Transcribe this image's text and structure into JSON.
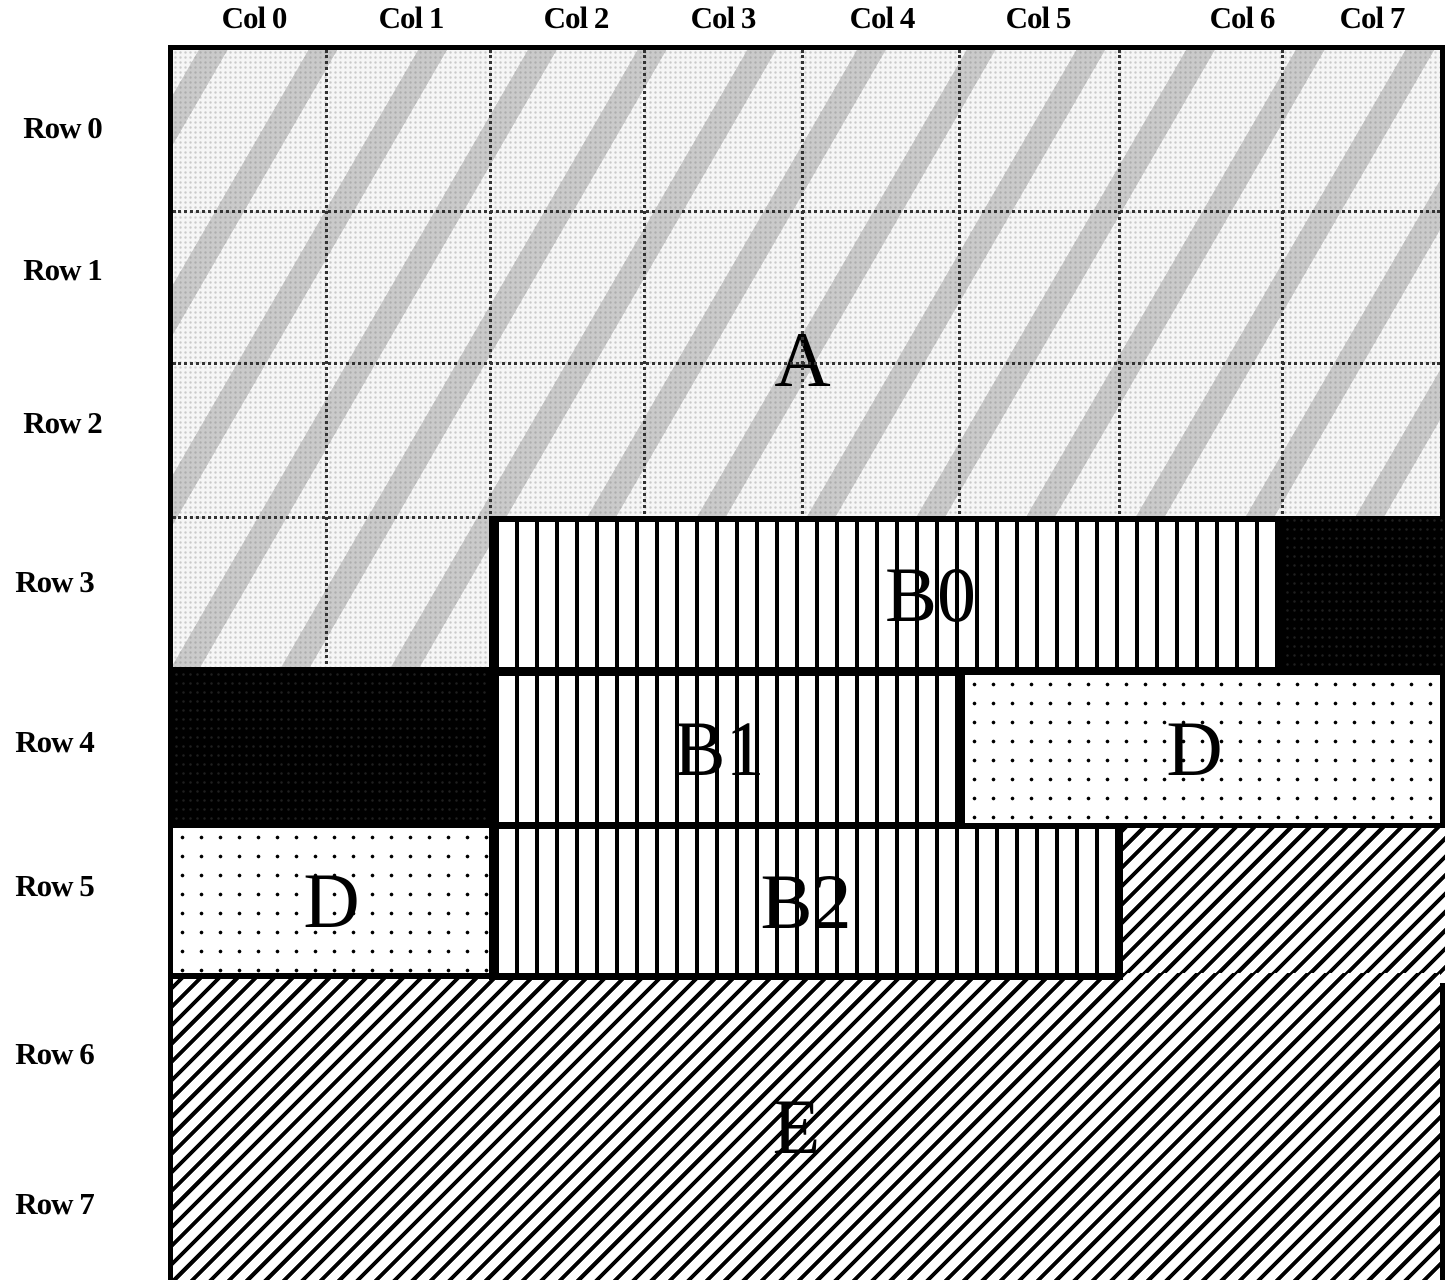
{
  "columns": [
    "Col 0",
    "Col 1",
    "Col 2",
    "Col 3",
    "Col 4",
    "Col 5",
    "Col 6",
    "Col 7"
  ],
  "rows": [
    "Row 0",
    "Row 1",
    "Row 2",
    "Row 3",
    "Row 4",
    "Row 5",
    "Row 6",
    "Row 7"
  ],
  "regions": {
    "A": {
      "label": "A",
      "pattern": "mottled-gray"
    },
    "B0": {
      "label": "B0",
      "pattern": "vertical-stripes"
    },
    "B1": {
      "label": "B1",
      "pattern": "vertical-stripes"
    },
    "B2": {
      "label": "B2",
      "pattern": "vertical-stripes"
    },
    "C_top_right": {
      "label": "",
      "pattern": "solid-black"
    },
    "C_left": {
      "label": "",
      "pattern": "solid-black"
    },
    "D_right": {
      "label": "D",
      "pattern": "dots"
    },
    "D_left": {
      "label": "D",
      "pattern": "dots"
    },
    "E": {
      "label": "E",
      "pattern": "diagonal-hatch"
    }
  },
  "colors": {
    "ink": "#000000",
    "paper": "#ffffff",
    "gray": "#9a9a9a"
  }
}
